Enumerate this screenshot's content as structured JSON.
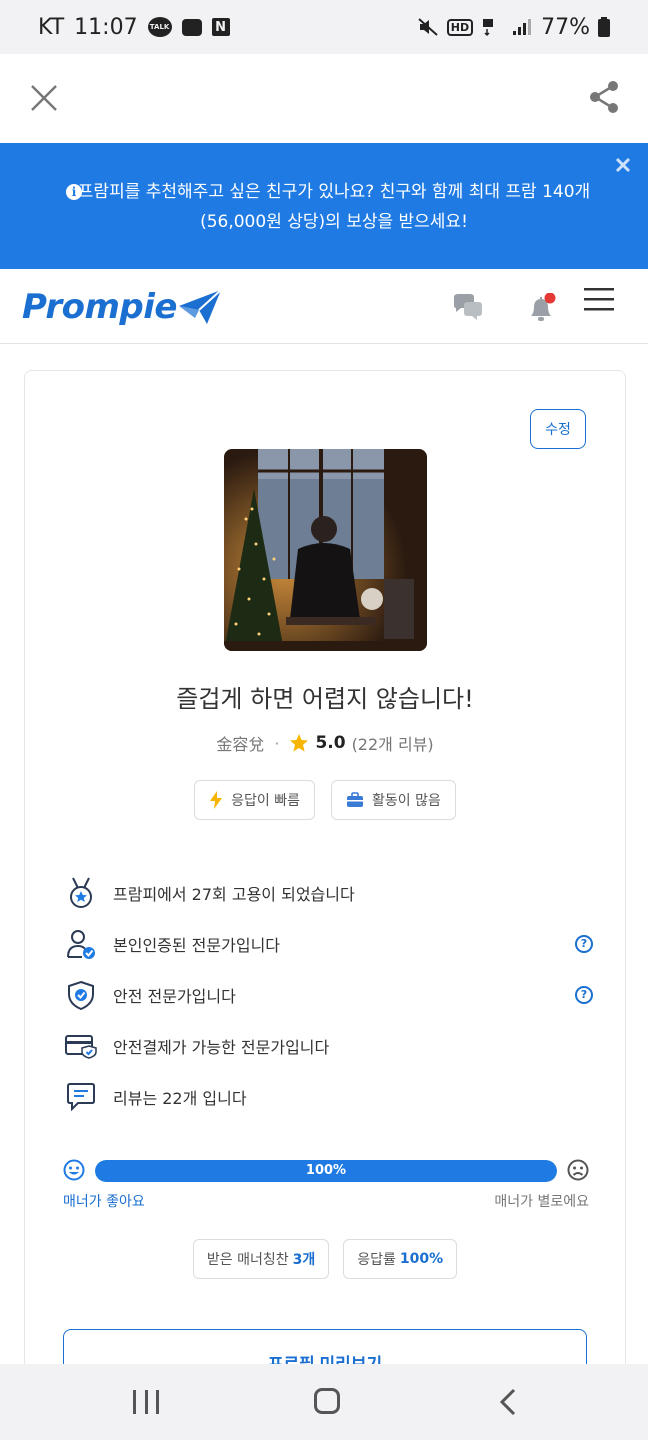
{
  "status_bar": {
    "carrier": "KT",
    "time": "11:07",
    "kakao_label": "TALK",
    "n_badge": "N",
    "hd_label": "HD",
    "battery": "77%"
  },
  "top_nav": {
    "close_icon": "close-icon",
    "share_icon": "share-icon"
  },
  "banner": {
    "text": "프람피를 추천해주고 싶은 친구가 있나요? 친구와 함께 최대 프람 140개 (56,000원 상당)의 보상을 받으세요!",
    "info_glyph": "i",
    "background": "#1f7be3"
  },
  "header": {
    "logo": "Prompie",
    "brand_color": "#1a6fd0",
    "notification_dot_color": "#e53935"
  },
  "profile": {
    "edit_label": "수정",
    "headline": "즐겁게 하면 어렵지 않습니다!",
    "name": "金容兌",
    "rating": "5.0",
    "review_count": "(22개 리뷰)",
    "tags": [
      {
        "label": "응답이 빠름",
        "icon": "lightning-icon"
      },
      {
        "label": "활동이 많음",
        "icon": "briefcase-icon"
      }
    ],
    "features": [
      {
        "text": "프람피에서 27회 고용이 되었습니다",
        "icon": "medal-icon",
        "help": false
      },
      {
        "text": "본인인증된 전문가입니다",
        "icon": "verified-user-icon",
        "help": true
      },
      {
        "text": "안전 전문가입니다",
        "icon": "shield-check-icon",
        "help": true
      },
      {
        "text": "안전결제가 가능한 전문가입니다",
        "icon": "card-shield-icon",
        "help": false
      },
      {
        "text": "리뷰는 22개 입니다",
        "icon": "chat-review-icon",
        "help": false
      }
    ],
    "help_glyph": "?",
    "manner": {
      "percent": 100,
      "label": "100%",
      "good": "매너가 좋아요",
      "bad": "매너가 별로에요"
    },
    "stats": [
      {
        "label": "받은 매너칭찬",
        "value": "3개"
      },
      {
        "label": "응답률",
        "value": "100%"
      }
    ],
    "preview_label": "프로필 미리보기"
  }
}
